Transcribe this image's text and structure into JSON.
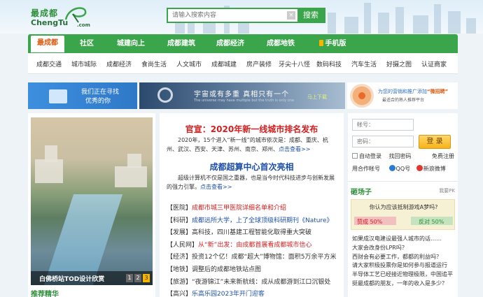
{
  "logo": {
    "cn": "最成都",
    "en": "ChengTu",
    "com": ".com"
  },
  "search": {
    "placeholder": "请输入搜索内容",
    "clear": "×",
    "button": "搜索"
  },
  "nav": {
    "items": [
      "最成都",
      "社区",
      "城建向上",
      "成都建筑",
      "成都经济",
      "成都地铁",
      "手机版"
    ],
    "subitems": [
      "成都交通",
      "城市城际",
      "成都经济",
      "食尚生活",
      "人文城市",
      "成都城建",
      "房产装修",
      "牙尖十八怪",
      "数码科技",
      "汽车生活",
      "好摄之图",
      "认证商家"
    ]
  },
  "banners": {
    "recruit": {
      "line1": "我们正在寻找",
      "line2": "优秀的你"
    },
    "main": {
      "title": "宇宙或有多重   真相只有一个",
      "subtitle": "The universe may have multiple but the truth is only one",
      "tag": "马上下载"
    },
    "wechat": {
      "prefix": "为您的营销和推广添加",
      "highlight": "“微招聘”",
      "line2": "最适合的熟人推荐平台"
    }
  },
  "slideshow": {
    "caption": "白佛桥站TOD设计欣赏",
    "pages": [
      "1",
      "2",
      "3"
    ],
    "current": "3"
  },
  "recommend": "推荐精华",
  "center": {
    "headline1": "官宣：2020年新一线城市排名发布",
    "summary1": "2020年，15个进入“新一线”的城市依次是：成都、重庆、杭州、武汉、西安、天津、苏州、南京、郑州、",
    "more1": "点击查看>>",
    "headline2": "成都超算中心首次亮相",
    "summary2": "超级计算机不仅是国之重器，也是当今时代科技进步与创新发展的强力引擎。",
    "more2": "点击查看>>",
    "news": [
      {
        "cat": "【医院】",
        "title": "成都市城三甲医院详细名单和介绍",
        "color": "red"
      },
      {
        "cat": "【科研】",
        "title": "成都远所大学，上了全球顶级科研期刊《Nature》",
        "color": "blue"
      },
      {
        "cat": "【发展】",
        "title": "高科技，四川基建工程智能化取得重大突破",
        "color": ""
      },
      {
        "cat": "【人民网】",
        "title": "从“新”出发：由成都首展看成都城市信心",
        "color": "red"
      },
      {
        "cat": "【经济】",
        "title": "投资12个亿！成都“超大”博物馆：面积5万余平方米",
        "color": ""
      },
      {
        "cat": "【地铁】",
        "title": "调整后的成都地铁站点图",
        "color": ""
      },
      {
        "cat": "【旅游】",
        "title": "“夜游锦江”未来新航线：成从成都游到江口沉银处",
        "color": ""
      },
      {
        "cat": "【高兴】",
        "title": "乐高乐园2023年开门迎客",
        "color": "blue"
      }
    ]
  },
  "login": {
    "username_placeholder": "帐号：",
    "password_placeholder": "密码：",
    "button": "登 录",
    "auto_login": "自动登录",
    "forgot": "找回密码",
    "register": "免费注册",
    "other": "用合作帐号",
    "qq": "QQ号",
    "weibo": "新浪微博"
  },
  "arena": {
    "title": "砸场子",
    "more": "我要PK",
    "question": "你认为应该抵制游戏A梦吗?",
    "option_a": "赞成 50%",
    "option_b": "反对 50%",
    "support_pct": 50,
    "oppose_pct": 50
  },
  "topics": [
    "如果成汉电建设最强人城市的话……",
    "大家会改身份LPR吗？",
    "西财会有必要工作，都都的利益吗？",
    "请大家积极投票你是如何参与报道运行",
    "半导体工艺已经接近物理极限，中国追平",
    "挺最成都的朋友，一年的收入是多少？"
  ]
}
